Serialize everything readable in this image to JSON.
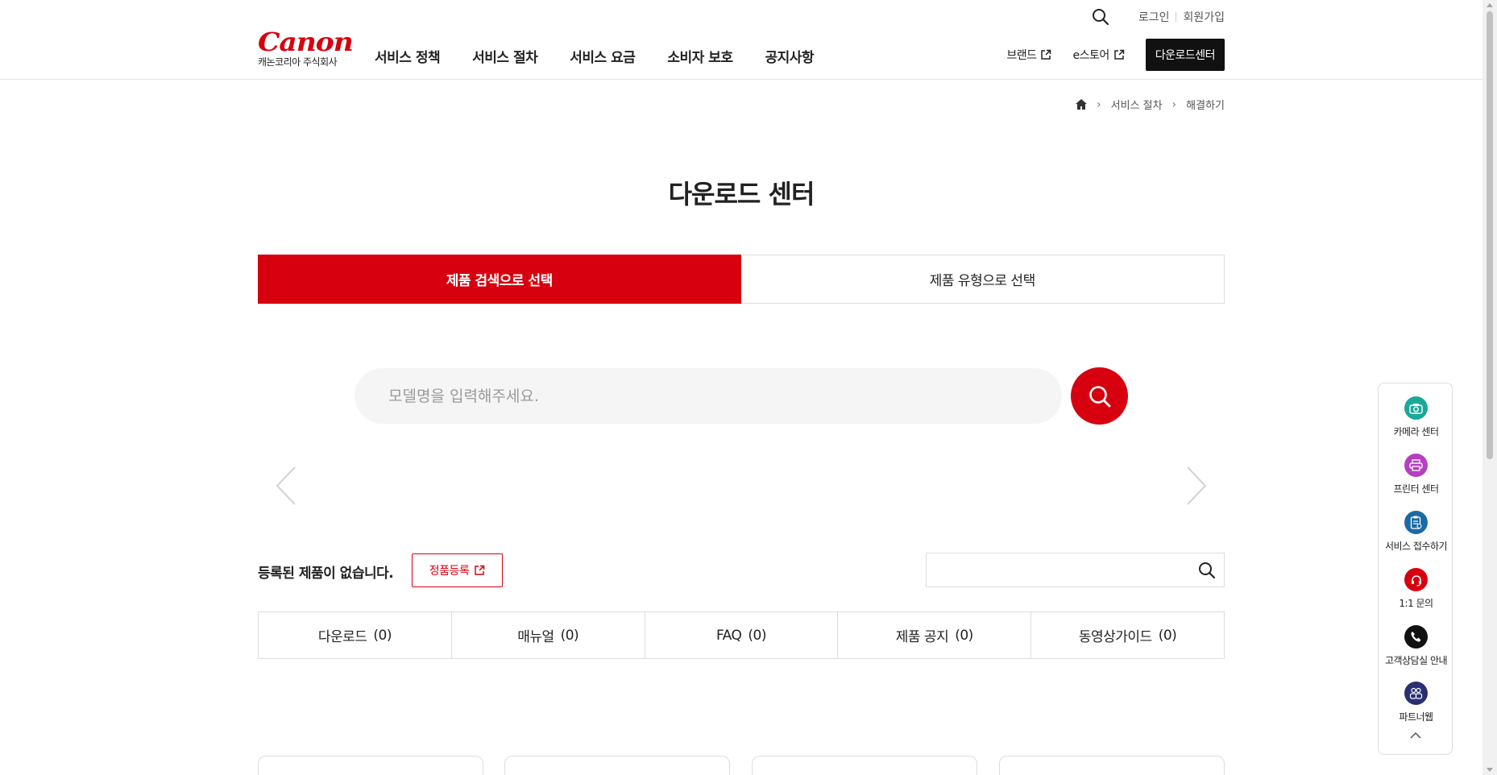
{
  "header": {
    "logo_word": "Canon",
    "logo_sub": "캐논코리아 주식회사",
    "util": {
      "login": "로그인",
      "join": "회원가입"
    },
    "nav": [
      "서비스 정책",
      "서비스 절차",
      "서비스 요금",
      "소비자 보호",
      "공지사항"
    ],
    "external_links": [
      "브랜드",
      "e스토어"
    ],
    "download_center_button": "다운로드센터"
  },
  "breadcrumb": [
    "서비스 절차",
    "해결하기"
  ],
  "page_title": "다운로드 센터",
  "tabs": [
    {
      "label": "제품 검색으로 선택",
      "active": true
    },
    {
      "label": "제품 유형으로 선택",
      "active": false
    }
  ],
  "model_search": {
    "placeholder": "모델명을 입력해주세요.",
    "value": ""
  },
  "registered": {
    "message": "등록된 제품이 없습니다.",
    "register_button": "정품등록"
  },
  "filter_search": {
    "value": ""
  },
  "counts": [
    {
      "label": "다운로드",
      "count": "(0)"
    },
    {
      "label": "매뉴얼",
      "count": "(0)"
    },
    {
      "label": "FAQ",
      "count": "(0)"
    },
    {
      "label": "제품 공지",
      "count": "(0)"
    },
    {
      "label": "동영상가이드",
      "count": "(0)"
    }
  ],
  "quick_menu": [
    {
      "label": "카메라 센터",
      "icon": "camera-icon",
      "color": "#1aa89a"
    },
    {
      "label": "프린터 센터",
      "icon": "printer-icon",
      "color": "#b43fbf"
    },
    {
      "label": "서비스 접수하기",
      "icon": "clipboard-icon",
      "color": "#1b6aa3"
    },
    {
      "label": "1:1 문의",
      "icon": "headset-icon",
      "color": "#d7000f"
    },
    {
      "label": "고객상담실 안내",
      "icon": "phone-icon",
      "color": "#111111"
    },
    {
      "label": "파트너웹",
      "icon": "partner-icon",
      "color": "#2b2f72"
    }
  ],
  "colors": {
    "brand": "#d7000f",
    "dark": "#111111",
    "border": "#dddddd"
  }
}
